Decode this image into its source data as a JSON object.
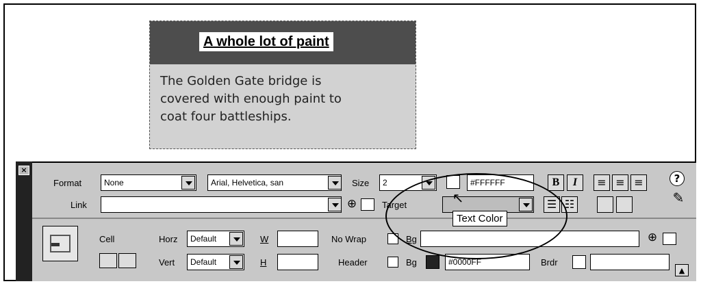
{
  "card": {
    "title": "A whole lot of paint",
    "body_lines": [
      "The Golden Gate bridge is",
      "covered with enough paint to",
      "coat four battleships."
    ]
  },
  "props": {
    "close_icon": "×",
    "format_label": "Format",
    "format_value": "None",
    "font_value": "Arial, Helvetica, san",
    "size_label": "Size",
    "size_value": "2",
    "text_color_value": "#FFFFFF",
    "bold_label": "B",
    "italic_label": "I",
    "link_label": "Link",
    "link_value": "",
    "target_label": "Target",
    "tooltip": "Text Color",
    "cell_label": "Cell",
    "horz_label": "Horz",
    "horz_value": "Default",
    "vert_label": "Vert",
    "vert_value": "Default",
    "w_label": "W",
    "h_label": "H",
    "nowrap_label": "No Wrap",
    "header_label": "Header",
    "bg_label": "Bg",
    "bg_color_value": "#0000FF",
    "brdr_label": "Brdr",
    "help_icon": "?",
    "edit_icon": "✎"
  },
  "colors": {
    "card_header": "#4d4d4d",
    "card_body": "#d2d2d2",
    "panel": "#c8c8c8",
    "bg_swatch": "#222222"
  }
}
